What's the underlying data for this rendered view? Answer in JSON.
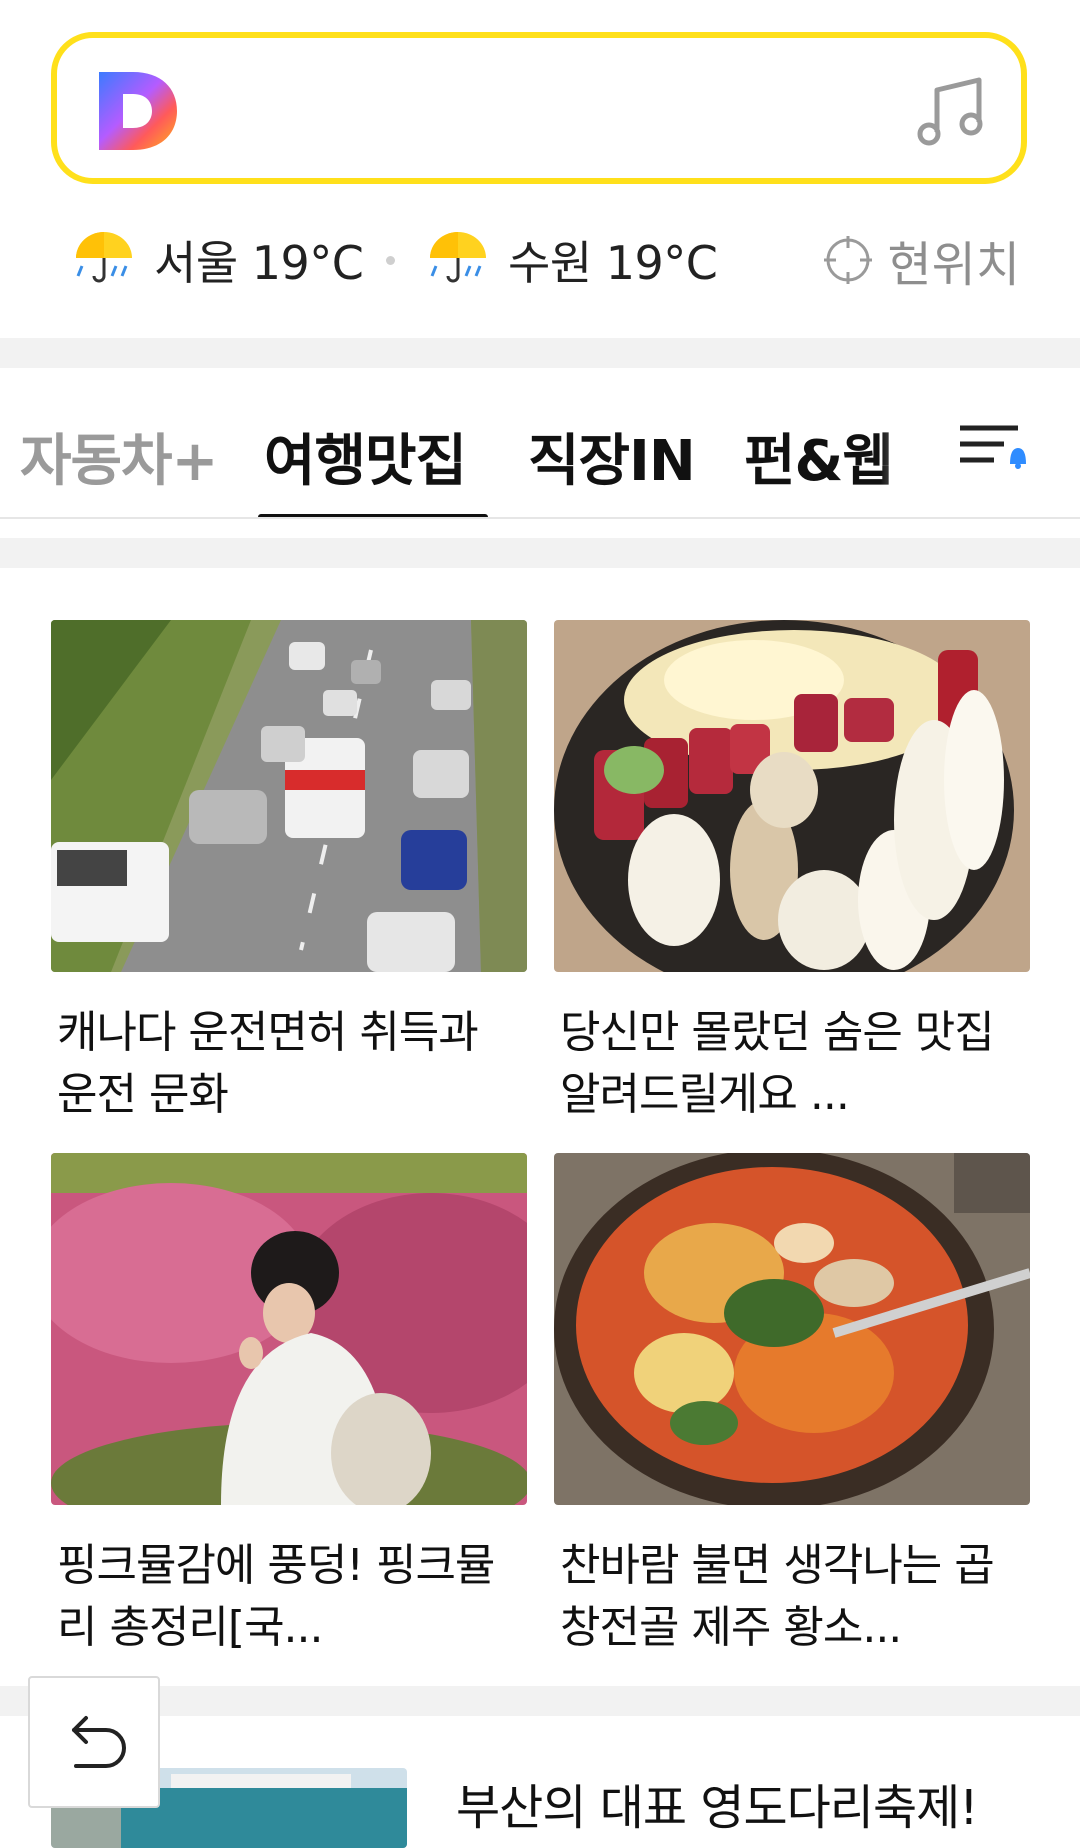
{
  "search": {
    "placeholder": ""
  },
  "weather": {
    "city1": "서울 19°C",
    "city2": "수원 19°C",
    "location_label": "현위치"
  },
  "tabs": [
    {
      "label": "자동차+"
    },
    {
      "label": "여행맛집",
      "selected": true
    },
    {
      "label": "직장IN"
    },
    {
      "label": "펀&웹"
    }
  ],
  "articles": [
    {
      "title": "캐나다 운전면허 취득과 운전 문화"
    },
    {
      "title": "당신만 몰랐던 숨은 맛집 알려드릴게요 ..."
    },
    {
      "title": "핑크뮬감에 풍덩! 핑크뮬리 총정리[국..."
    },
    {
      "title": "찬바람 불면 생각나는 곱창전골 제주 황소..."
    }
  ],
  "bottom_article": {
    "title": "부산의 대표 영도다리축제!"
  },
  "colors": {
    "accent": "#ffe01b",
    "notification": "#2f8cff"
  }
}
